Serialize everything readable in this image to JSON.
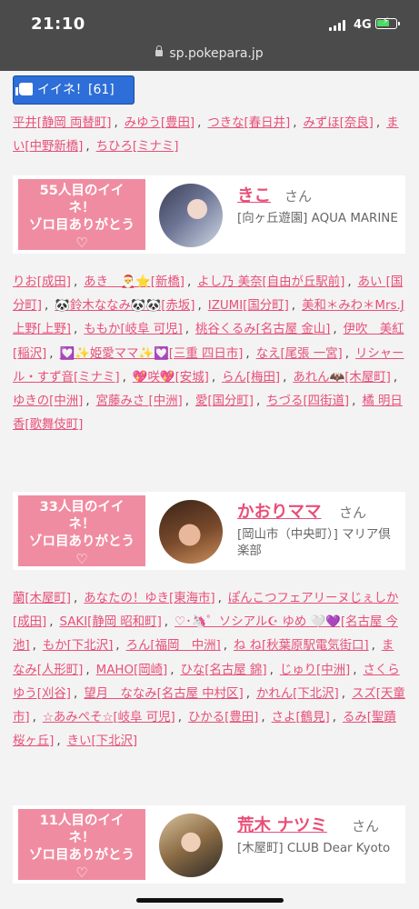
{
  "status": {
    "time": "21:10",
    "network": "4G",
    "battery_level": 0.72,
    "battery_color": "#4cd964"
  },
  "browser": {
    "url": "sp.pokepara.jp"
  },
  "iine": {
    "label": "イイネ！[61]",
    "icon": "thumbs-up-icon"
  },
  "list1": [
    {
      "name": "平井[静岡 両替町]"
    },
    {
      "name": "みゆう[豊田]"
    },
    {
      "name": "つきな[春日井]"
    },
    {
      "name": "みずほ[奈良]"
    },
    {
      "name": "まい[中野新橋]"
    },
    {
      "name": "ちひろ[ミナミ]"
    }
  ],
  "cards": [
    {
      "badge_line1": "55人目のイイ",
      "badge_line2": "ネ！",
      "badge_line3": "ゾロ目ありがとう",
      "badge_heart": "♡",
      "name": "きこ",
      "san": "さん",
      "shop": "[向ヶ丘遊園] AQUA MARINE",
      "avatar": "portrait-photo"
    },
    {
      "badge_line1": "33人目のイイ",
      "badge_line2": "ネ！",
      "badge_line3": "ゾロ目ありがとう",
      "badge_heart": "♡",
      "name": "かおりママ",
      "san": "さん",
      "shop": "[岡山市（中央町）] マリア倶楽部",
      "avatar": "portrait-photo"
    },
    {
      "badge_line1": "11人目のイイ",
      "badge_line2": "ネ！",
      "badge_line3": "ゾロ目ありがとう",
      "badge_heart": "♡",
      "name": "荒木 ナツミ",
      "san": "さん",
      "shop": "[木屋町] CLUB Dear Kyoto",
      "avatar": "portrait-photo"
    }
  ],
  "list2": [
    "りお[成田]",
    "あき＿🎅⭐[新橋]",
    "よし乃 美奈[自由が丘駅前]",
    "あい [国分町]",
    "🐼鈴木ななみ🐼🐼[赤坂]",
    "IZUMI[国分町]",
    "美和＊みわ＊Mrs.J上野[上野]",
    "ももか[岐阜 可児]",
    "桃谷くるみ[名古屋 金山]",
    "伊吹　美紅[稲沢]",
    "💟✨姫愛ママ✨💟[三重 四日市]",
    "なえ[尾張 一宮]",
    "リシャール・すず音[ミナミ]",
    "💖咲💖[安城]",
    "らん[梅田]",
    "あれん🦇[木屋町]",
    "ゆきの[中洲]",
    "宮藤みさ [中洲]",
    "愛[国分町]",
    "ちづる[四街道]",
    "橘 明日香[歌舞伎町]"
  ],
  "list3": [
    "蘭[木屋町]",
    "あなたの！ゆき[東海市]",
    "ぽんこつフェアリーヌじぇしか[成田]",
    "SAKI[静岡 昭和町]",
    "♡･🦄゜ソシアル☪ ゆめ 🤍💜[名古屋 今池]",
    "もか[下北沢]",
    "ろん[福岡　中洲]",
    "ね ね[秋葉原駅電気街口]",
    "まなみ[人形町]",
    "MAHO[岡崎]",
    "ひな[名古屋 錦]",
    "じゅり[中洲]",
    "さくら ゆう[刈谷]",
    "望月　ななみ[名古屋 中村区]",
    "かれん[下北沢]",
    "スズ[天童市]",
    "☆あみぺそ☆[岐阜 可児]",
    "ひかる[豊田]",
    "さよ[鶴見]",
    "るみ[聖蹟桜ヶ丘]",
    "きい[下北沢]"
  ],
  "colors": {
    "accent": "#e84f78",
    "badge": "#f08ca1",
    "button": "#2d6ed8",
    "statusbar": "#4b4b4b"
  }
}
